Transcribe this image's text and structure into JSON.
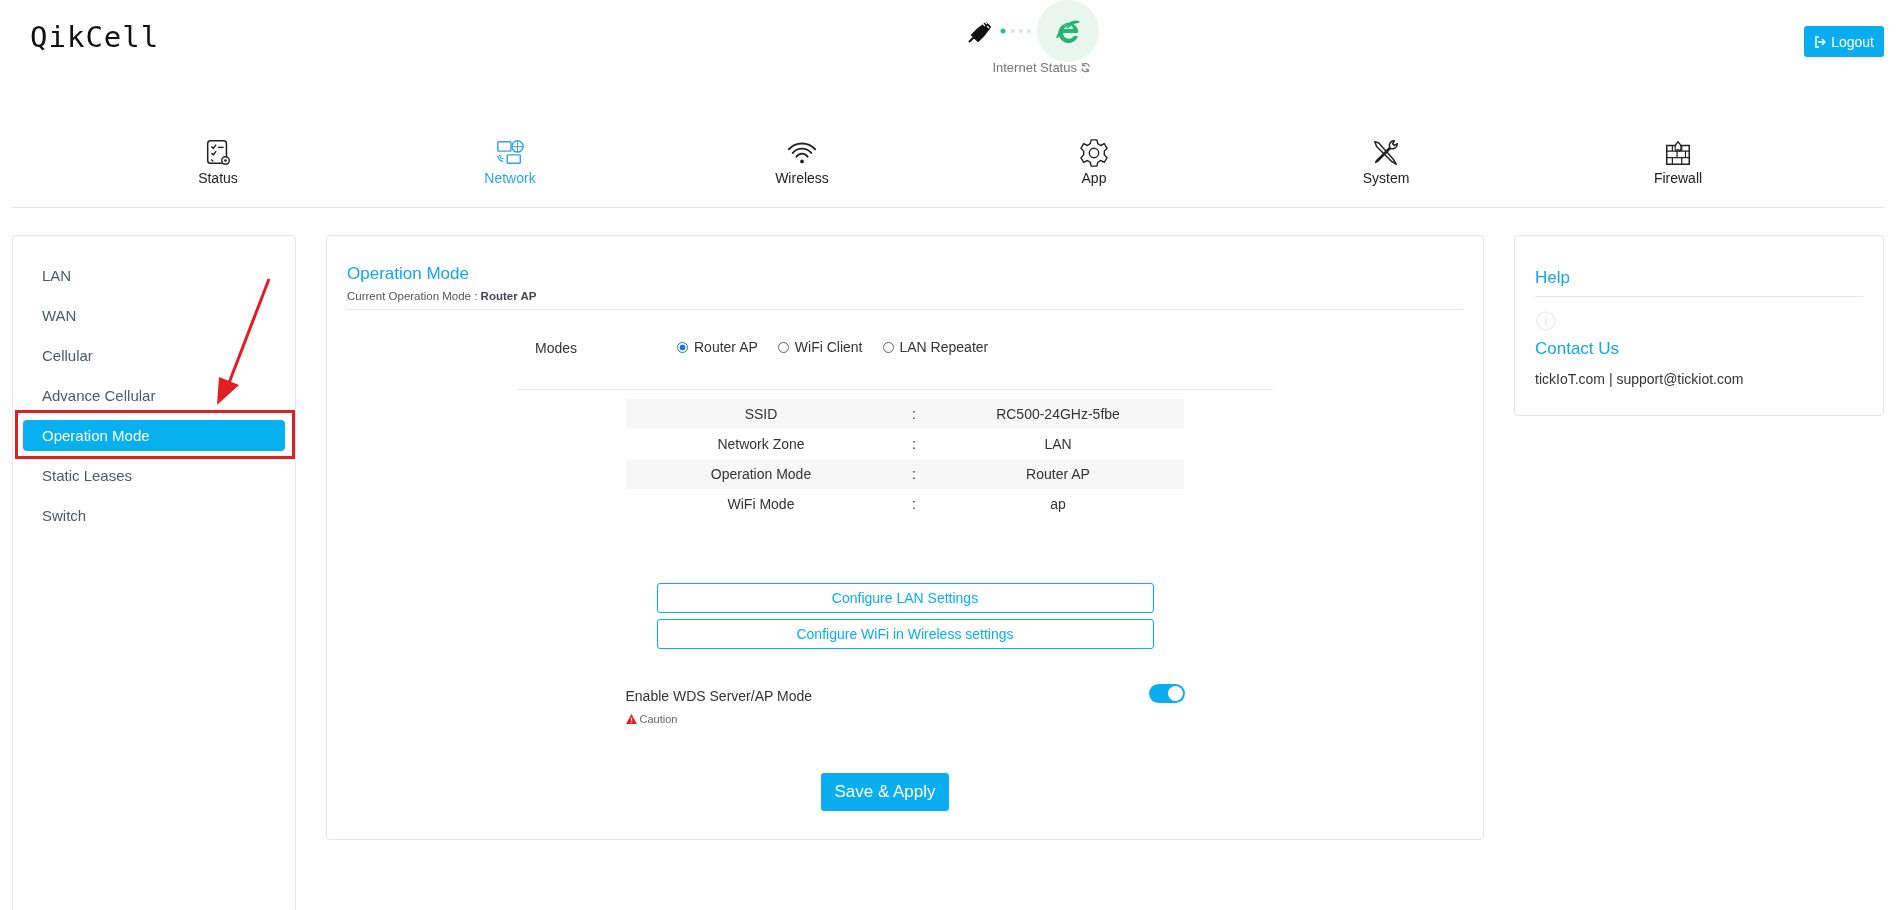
{
  "header": {
    "logo": "QikCell",
    "internet_status": {
      "label": "Internet Status",
      "connected": true
    },
    "logout": "Logout"
  },
  "nav": [
    {
      "label": "Status",
      "kind": "checklist",
      "selected": false
    },
    {
      "label": "Network",
      "kind": "network",
      "selected": true
    },
    {
      "label": "Wireless",
      "kind": "wifi",
      "selected": false
    },
    {
      "label": "App",
      "kind": "gear",
      "selected": false
    },
    {
      "label": "System",
      "kind": "tools",
      "selected": false
    },
    {
      "label": "Firewall",
      "kind": "firewall",
      "selected": false
    }
  ],
  "sidebar": {
    "items": [
      {
        "label": "LAN",
        "selected": false,
        "annotated": false
      },
      {
        "label": "WAN",
        "selected": false,
        "annotated": false
      },
      {
        "label": "Cellular",
        "selected": false,
        "annotated": false
      },
      {
        "label": "Advance Cellular",
        "selected": false,
        "annotated": false
      },
      {
        "label": "Operation Mode",
        "selected": true,
        "annotated": true
      },
      {
        "label": "Static Leases",
        "selected": false,
        "annotated": false
      },
      {
        "label": "Switch",
        "selected": false,
        "annotated": false
      }
    ]
  },
  "main": {
    "title": "Operation Mode",
    "subtitle": "Current Operation Mode : **Router AP**",
    "modes": {
      "label": "Modes",
      "options": [
        {
          "label": "Router AP",
          "selected": true
        },
        {
          "label": "WiFi Client",
          "selected": false
        },
        {
          "label": "LAN Repeater",
          "selected": false
        }
      ]
    },
    "info_rows": [
      {
        "label": "SSID",
        "sep": ":",
        "value": "RC500-24GHz-5fbe"
      },
      {
        "label": "Network Zone",
        "sep": ":",
        "value": "LAN"
      },
      {
        "label": "Operation Mode",
        "sep": ":",
        "value": "Router AP"
      },
      {
        "label": "WiFi Mode",
        "sep": ":",
        "value": "ap"
      }
    ],
    "links": [
      "Configure LAN Settings",
      "Configure WiFi in Wireless settings"
    ],
    "wds": {
      "label": "Enable WDS Server/AP Mode",
      "on": true,
      "caution": "Caution"
    },
    "save": "Save & Apply"
  },
  "help": {
    "title": "Help",
    "contact_title": "Contact Us",
    "contact_text": "tickIoT.com | support@tickiot.com"
  }
}
